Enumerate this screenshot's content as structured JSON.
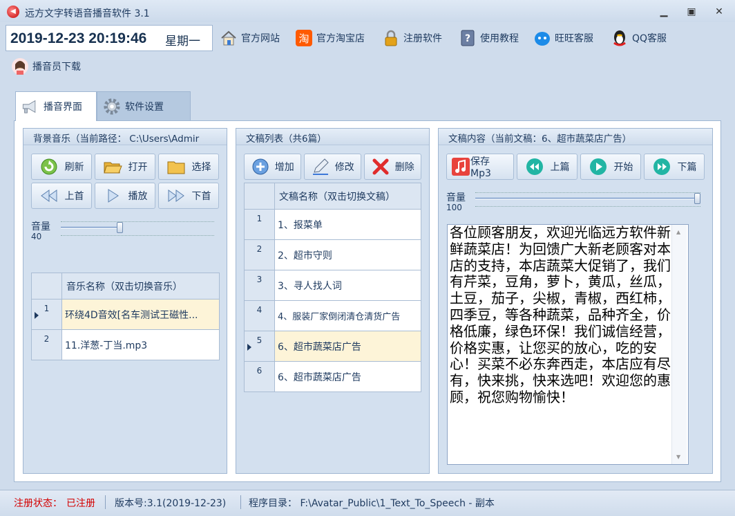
{
  "window": {
    "title": "远方文字转语音播音软件 3.1",
    "app_icon": "speaker-icon"
  },
  "header": {
    "date_time": "2019-12-23 20:19:46",
    "weekday": "星期一",
    "nav": [
      {
        "label": "官方网站",
        "icon": "home-icon"
      },
      {
        "label": "官方淘宝店",
        "icon": "taobao-icon"
      },
      {
        "label": "注册软件",
        "icon": "lock-icon"
      },
      {
        "label": "使用教程",
        "icon": "help-book-icon"
      },
      {
        "label": "旺旺客服",
        "icon": "wangwang-icon"
      },
      {
        "label": "QQ客服",
        "icon": "qq-penguin-icon"
      },
      {
        "label": "播音员下载",
        "icon": "announcer-avatar-icon"
      }
    ]
  },
  "tabs": [
    {
      "label": "播音界面",
      "icon": "megaphone-icon",
      "active": true
    },
    {
      "label": "软件设置",
      "icon": "gear-icon",
      "active": false
    }
  ],
  "music_panel": {
    "title": "背景音乐（当前路径： C:\\Users\\Admir",
    "buttons": {
      "refresh": "刷新",
      "open": "打开",
      "select": "选择",
      "prev": "上首",
      "play": "播放",
      "next": "下首"
    },
    "volume_label": "音量",
    "volume_value": "40",
    "volume_level": 0.4,
    "table_header": "音乐名称（双击切换音乐）",
    "rows": [
      {
        "num": "1",
        "name": "环绕4D音效[名车测试王磁性...",
        "selected": true
      },
      {
        "num": "2",
        "name": "11.洋葱-丁当.mp3",
        "selected": false
      }
    ]
  },
  "script_panel": {
    "title": "文稿列表（共6篇）",
    "buttons": {
      "add": "增加",
      "edit": "修改",
      "delete": "删除"
    },
    "table_header": "文稿名称（双击切换文稿）",
    "rows": [
      {
        "num": "1",
        "name": "1、报菜单",
        "selected": false
      },
      {
        "num": "2",
        "name": "2、超市守则",
        "selected": false
      },
      {
        "num": "3",
        "name": "3、寻人找人词",
        "selected": false
      },
      {
        "num": "4",
        "name": "4、服装厂家倒闭清仓清货广告",
        "selected": false
      },
      {
        "num": "5",
        "name": "6、超市蔬菜店广告",
        "selected": true
      },
      {
        "num": "6",
        "name": "6、超市蔬菜店广告",
        "selected": false
      }
    ]
  },
  "content_panel": {
    "title": "文稿内容（当前文稿：6、超市蔬菜店广告）",
    "buttons": {
      "save_mp3": "保存Mp3",
      "prev": "上篇",
      "start": "开始",
      "next": "下篇"
    },
    "volume_label": "音量",
    "volume_value": "100",
    "volume_level": 1.0,
    "text": "各位顾客朋友，欢迎光临远方软件新鲜蔬菜店！为回馈广大新老顾客对本店的支持，本店蔬菜大促销了，我们有芹菜，豆角，萝卜，黄瓜，丝瓜，土豆，茄子，尖椒，青椒，西红柿，四季豆，等各种蔬菜，品种齐全，价格低廉，绿色环保！我们诚信经营，价格实惠，让您买的放心，吃的安心！买菜不必东奔西走，本店应有尽有，快来挑，快来选吧！欢迎您的惠顾，祝您购物愉快！"
  },
  "status": {
    "reg_label": "注册状态：",
    "reg_value": "已注册",
    "version": "版本号:3.1(2019-12-23)",
    "path": "程序目录： F:\\Avatar_Public\\1_Text_To_Speech - 副本"
  },
  "colors": {
    "accent": "#1e3a5f",
    "registered": "#d40000",
    "selected_row": "#fdf4d8"
  }
}
